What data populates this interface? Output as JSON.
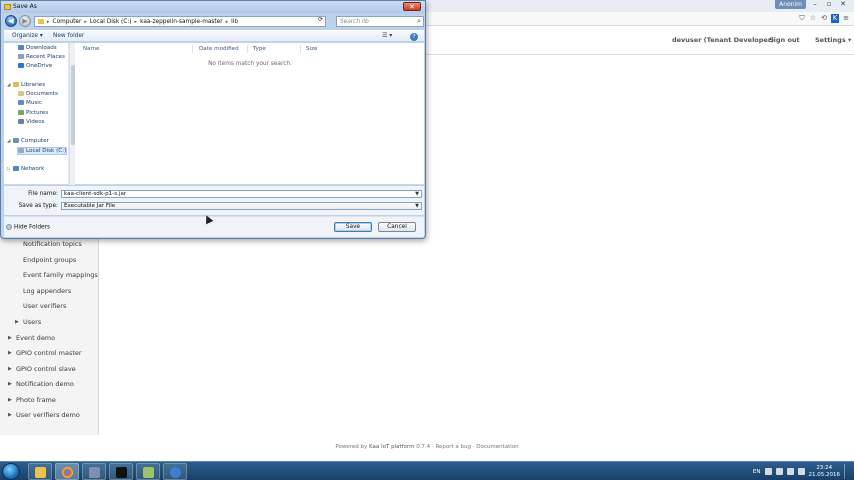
{
  "browser": {
    "user_badge": "Anonim",
    "win_minimize": "–",
    "win_maximize": "▫",
    "win_close": "✕",
    "addr_icons": [
      "⛉",
      "☆",
      "⟲",
      "K",
      "≡"
    ]
  },
  "kaa_header": {
    "user": "devuser (Tenant Developer)",
    "sign_out": "Sign out",
    "settings": "Settings"
  },
  "sidebar": {
    "sub_items": [
      "Notification topics",
      "Endpoint groups",
      "Event family mappings",
      "Log appenders",
      "User verifiers",
      "Users"
    ],
    "apps": [
      "Event demo",
      "GPIO control master",
      "GPIO control slave",
      "Notification demo",
      "Photo frame",
      "User verifiers demo"
    ]
  },
  "footer": {
    "powered_by": "Powered by",
    "brand": "Kaa IoT platform",
    "version": "0.7.4",
    "report_bug": "Report a bug",
    "documentation": "Documentation"
  },
  "taskbar": {
    "lang": "EN",
    "time": "23:24",
    "date": "21.05.2016"
  },
  "dialog": {
    "title": "Save As",
    "close_glyph": "✕",
    "breadcrumb": [
      "Computer",
      "Local Disk (C:)",
      "kaa-zeppelin-sample-master",
      "lib"
    ],
    "search_placeholder": "Search lib",
    "toolbar": {
      "organize": "Organize ▾",
      "new_folder": "New folder",
      "view": "☰ ▾",
      "help": "?"
    },
    "nav_tree": {
      "favorites": [
        "Downloads",
        "Recent Places",
        "OneDrive"
      ],
      "libraries_label": "Libraries",
      "libraries": [
        "Documents",
        "Music",
        "Pictures",
        "Videos"
      ],
      "computer_label": "Computer",
      "computer": [
        "Local Disk (C:)"
      ],
      "network_label": "Network"
    },
    "columns": [
      "Name",
      "Date modified",
      "Type",
      "Size"
    ],
    "empty_message": "No items match your search.",
    "file_name_label": "File name:",
    "file_name_value": "kaa-client-sdk-p1-s.jar",
    "save_type_label": "Save as type:",
    "save_type_value": "Executable Jar File",
    "hide_folders": "Hide Folders",
    "save_button": "Save",
    "cancel_button": "Cancel"
  }
}
